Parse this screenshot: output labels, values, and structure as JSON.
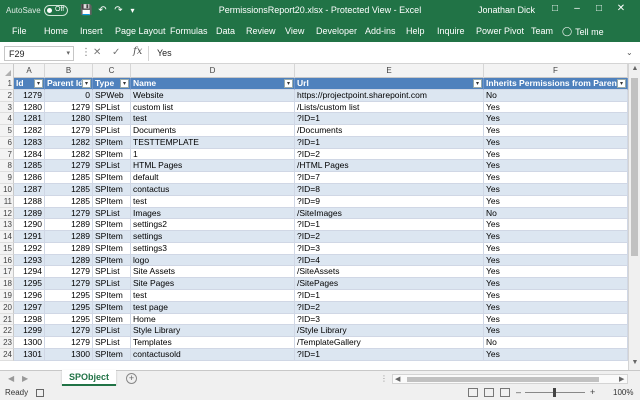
{
  "titlebar": {
    "autosave_label": "AutoSave",
    "autosave_state": "Off",
    "title": "PermissionsReport20.xlsx  -  Protected View  -  Excel",
    "user": "Jonathan Dick"
  },
  "ribbon": {
    "tabs": [
      "File",
      "Home",
      "Insert",
      "Page Layout",
      "Formulas",
      "Data",
      "Review",
      "View",
      "Developer",
      "Add-ins",
      "Help",
      "Inquire",
      "Power Pivot",
      "Team"
    ],
    "tell_me": "Tell me"
  },
  "formula_bar": {
    "name_box": "F29",
    "fx": "fx",
    "value": "Yes"
  },
  "columns": [
    "A",
    "B",
    "C",
    "D",
    "E",
    "F"
  ],
  "headers": [
    "Id",
    "Parent Id",
    "Type",
    "Name",
    "Url",
    "Inherits Permissions from Parent?"
  ],
  "row_numbers": [
    "1",
    "2",
    "3",
    "4",
    "5",
    "6",
    "7",
    "8",
    "9",
    "10",
    "11",
    "12",
    "13",
    "14",
    "15",
    "16",
    "17",
    "18",
    "19",
    "20",
    "21",
    "22",
    "23",
    "24"
  ],
  "rows": [
    [
      "1279",
      "0",
      "SPWeb",
      "Website",
      "https://projectpoint.sharepoint.com",
      "No"
    ],
    [
      "1280",
      "1279",
      "SPList",
      "custom list",
      "/Lists/custom list",
      "Yes"
    ],
    [
      "1281",
      "1280",
      "SPItem",
      "test",
      "?ID=1",
      "Yes"
    ],
    [
      "1282",
      "1279",
      "SPList",
      "Documents",
      "/Documents",
      "Yes"
    ],
    [
      "1283",
      "1282",
      "SPItem",
      "TESTTEMPLATE",
      "?ID=1",
      "Yes"
    ],
    [
      "1284",
      "1282",
      "SPItem",
      "1",
      "?ID=2",
      "Yes"
    ],
    [
      "1285",
      "1279",
      "SPList",
      "HTML Pages",
      "/HTML Pages",
      "Yes"
    ],
    [
      "1286",
      "1285",
      "SPItem",
      "default",
      "?ID=7",
      "Yes"
    ],
    [
      "1287",
      "1285",
      "SPItem",
      "contactus",
      "?ID=8",
      "Yes"
    ],
    [
      "1288",
      "1285",
      "SPItem",
      "test",
      "?ID=9",
      "Yes"
    ],
    [
      "1289",
      "1279",
      "SPList",
      "Images",
      "/SiteImages",
      "No"
    ],
    [
      "1290",
      "1289",
      "SPItem",
      "settings2",
      "?ID=1",
      "Yes"
    ],
    [
      "1291",
      "1289",
      "SPItem",
      "settings",
      "?ID=2",
      "Yes"
    ],
    [
      "1292",
      "1289",
      "SPItem",
      "settings3",
      "?ID=3",
      "Yes"
    ],
    [
      "1293",
      "1289",
      "SPItem",
      "logo",
      "?ID=4",
      "Yes"
    ],
    [
      "1294",
      "1279",
      "SPList",
      "Site Assets",
      "/SiteAssets",
      "Yes"
    ],
    [
      "1295",
      "1279",
      "SPList",
      "Site Pages",
      "/SitePages",
      "Yes"
    ],
    [
      "1296",
      "1295",
      "SPItem",
      "test",
      "?ID=1",
      "Yes"
    ],
    [
      "1297",
      "1295",
      "SPItem",
      "test page",
      "?ID=2",
      "Yes"
    ],
    [
      "1298",
      "1295",
      "SPItem",
      "Home",
      "?ID=3",
      "Yes"
    ],
    [
      "1299",
      "1279",
      "SPList",
      "Style Library",
      "/Style Library",
      "Yes"
    ],
    [
      "1300",
      "1279",
      "SPList",
      "Templates",
      "/TemplateGallery",
      "No"
    ],
    [
      "1301",
      "1300",
      "SPItem",
      "contactusold",
      "?ID=1",
      "Yes"
    ]
  ],
  "sheet_tab": "SPObject",
  "status": {
    "ready": "Ready",
    "zoom": "100%"
  },
  "colors": {
    "excel_green": "#217346",
    "table_header": "#4f81bd",
    "band": "#dce6f1"
  }
}
